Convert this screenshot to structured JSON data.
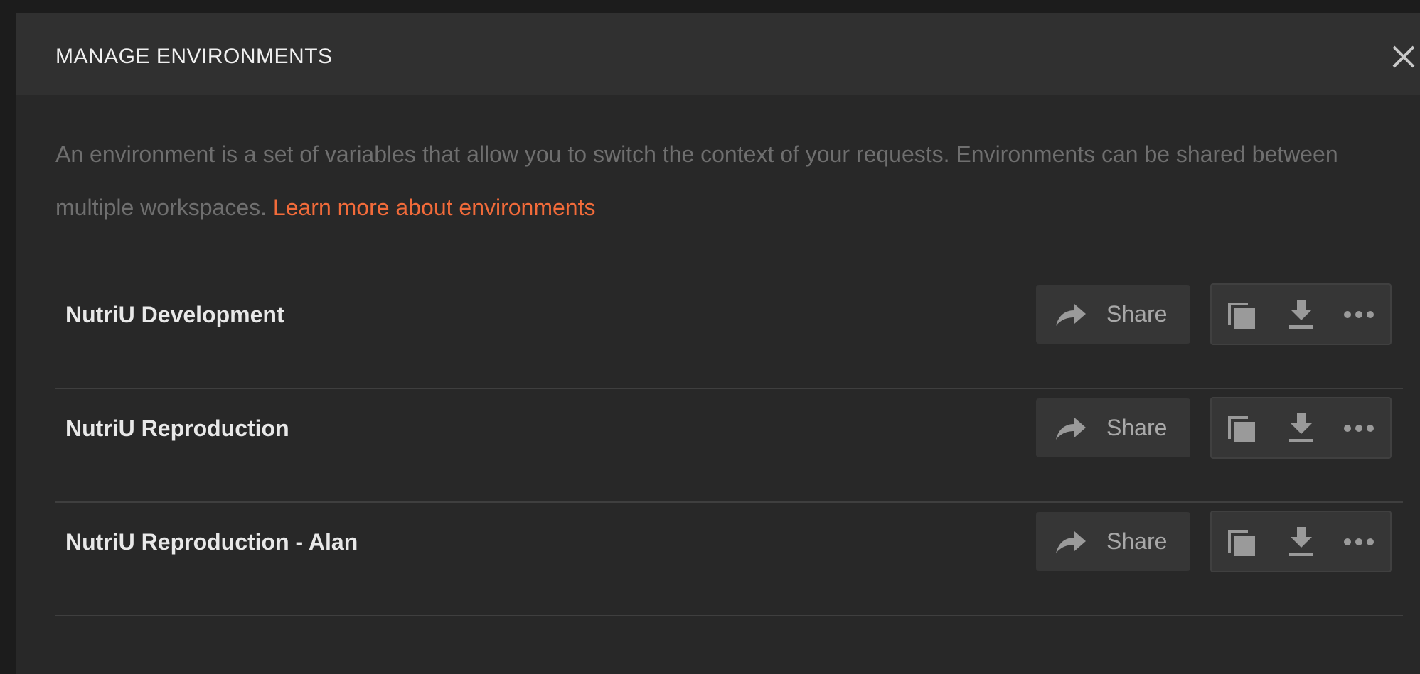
{
  "modal": {
    "title": "MANAGE ENVIRONMENTS",
    "close_icon": "close-icon",
    "description": "An environment is a set of variables that allow you to switch the context of your requests. Environments can be shared between multiple workspaces.",
    "learn_more_link": "Learn more about environments"
  },
  "environments": [
    {
      "name": "NutriU Development",
      "share_label": "Share"
    },
    {
      "name": "NutriU Reproduction",
      "share_label": "Share"
    },
    {
      "name": "NutriU Reproduction - Alan",
      "share_label": "Share"
    }
  ],
  "icons": {
    "share": "share-arrow-icon",
    "duplicate": "duplicate-icon",
    "download": "download-icon",
    "more": "more-options-icon"
  },
  "colors": {
    "accent": "#f26b3a",
    "background": "#282828",
    "header": "#303030",
    "button": "#363636",
    "icon": "#9a9a9a",
    "text_primary": "#e8e8e8",
    "text_muted": "#6f6f6f"
  }
}
